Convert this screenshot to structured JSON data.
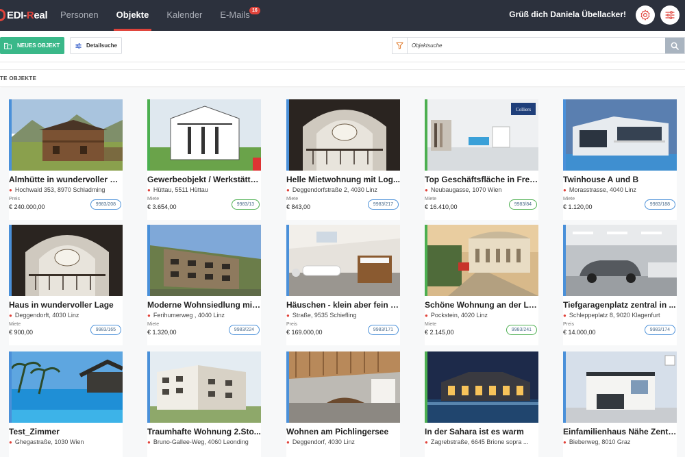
{
  "brand": {
    "prefix": "EDI-",
    "accent_letter": "R",
    "suffix": "eal",
    "accent_color": "#e0433b"
  },
  "nav": [
    {
      "label": "Personen",
      "active": false
    },
    {
      "label": "Objekte",
      "active": true
    },
    {
      "label": "Kalender",
      "active": false
    },
    {
      "label": "E-Mails",
      "active": false,
      "badge": "16"
    }
  ],
  "header": {
    "greeting": "Grüß dich Daniela Übellacker!",
    "settings_icon": "gear-icon",
    "filter_icon": "sliders-icon"
  },
  "toolbar": {
    "new_label": "NEUES OBJEKT",
    "detail_label": "Detailsuche",
    "search_placeholder": "Objektsuche",
    "accent": "#3ab889"
  },
  "section": {
    "title": "TE OBJEKTE"
  },
  "cards": [
    {
      "title": "Almhütte in wundervoller G...",
      "address": "Hochwald 353, 8970 Schladming",
      "price_label": "Preis",
      "price": "€ 240.000,00",
      "ref": "9983/208",
      "status": "blue"
    },
    {
      "title": "Gewerbeobjekt / Werkstätte...",
      "address": "Hüttau, 5511 Hüttau",
      "price_label": "Miete",
      "price": "€ 3.654,00",
      "ref": "9983/13",
      "status": "green"
    },
    {
      "title": "Helle Mietwohnung mit Log...",
      "address": "Deggendorfstraße 2, 4030 Linz",
      "price_label": "Miete",
      "price": "€ 843,00",
      "ref": "9983/217",
      "status": "blue"
    },
    {
      "title": "Top Geschäftsfläche in Freq...",
      "address": "Neubaugasse, 1070 Wien",
      "price_label": "Miete",
      "price": "€ 16.410,00",
      "ref": "9983/84",
      "status": "green"
    },
    {
      "title": "Twinhouse A und B",
      "address": "Morasstrasse, 4040 Linz",
      "price_label": "Miete",
      "price": "€ 1.120,00",
      "ref": "9983/188",
      "status": "blue"
    },
    {
      "title": "Haus in wundervoller Lage",
      "address": "Deggendorft, 4030 Linz",
      "price_label": "Miete",
      "price": "€ 900,00",
      "ref": "9983/165",
      "status": "blue"
    },
    {
      "title": "Moderne Wohnsiedlung mit ...",
      "address": "Ferihumerweg , 4040 Linz",
      "price_label": "Miete",
      "price": "€ 1.320,00",
      "ref": "9983/224",
      "status": "blue"
    },
    {
      "title": "Häuschen - klein aber fein - ...",
      "address": "Straße, 9535 Schiefling",
      "price_label": "Preis",
      "price": "€ 169.000,00",
      "ref": "9983/171",
      "status": "blue"
    },
    {
      "title": "Schöne Wohnung an der La...",
      "address": "Pockstein, 4020 Linz",
      "price_label": "Miete",
      "price": "€ 2.145,00",
      "ref": "9983/241",
      "status": "green"
    },
    {
      "title": "Tiefgaragenplatz zentral in ...",
      "address": "Schleppeplatz 8, 9020 Klagenfurt",
      "price_label": "Preis",
      "price": "€ 14.000,00",
      "ref": "9983/174",
      "status": "blue"
    },
    {
      "title": "Test_Zimmer",
      "address": "Ghegastraße, 1030 Wien",
      "price_label": "",
      "price": "",
      "ref": "",
      "status": "blue"
    },
    {
      "title": "Traumhafte Wohnung 2.Sto...",
      "address": "Bruno-Gallee-Weg, 4060 Leonding",
      "price_label": "",
      "price": "",
      "ref": "",
      "status": "blue"
    },
    {
      "title": "Wohnen am Pichlingersee",
      "address": "Deggendorf, 4030 Linz",
      "price_label": "",
      "price": "",
      "ref": "",
      "status": "blue"
    },
    {
      "title": "In der Sahara ist es warm",
      "address": "Zagrebstraße, 6645 Brione sopra ...",
      "price_label": "",
      "price": "",
      "ref": "",
      "status": "green"
    },
    {
      "title": "Einfamilienhaus Nähe Zentr...",
      "address": "Bieberweg, 8010 Graz",
      "price_label": "",
      "price": "",
      "ref": "",
      "status": "blue"
    }
  ],
  "image_labels": {
    "colliers": "Colliers"
  }
}
